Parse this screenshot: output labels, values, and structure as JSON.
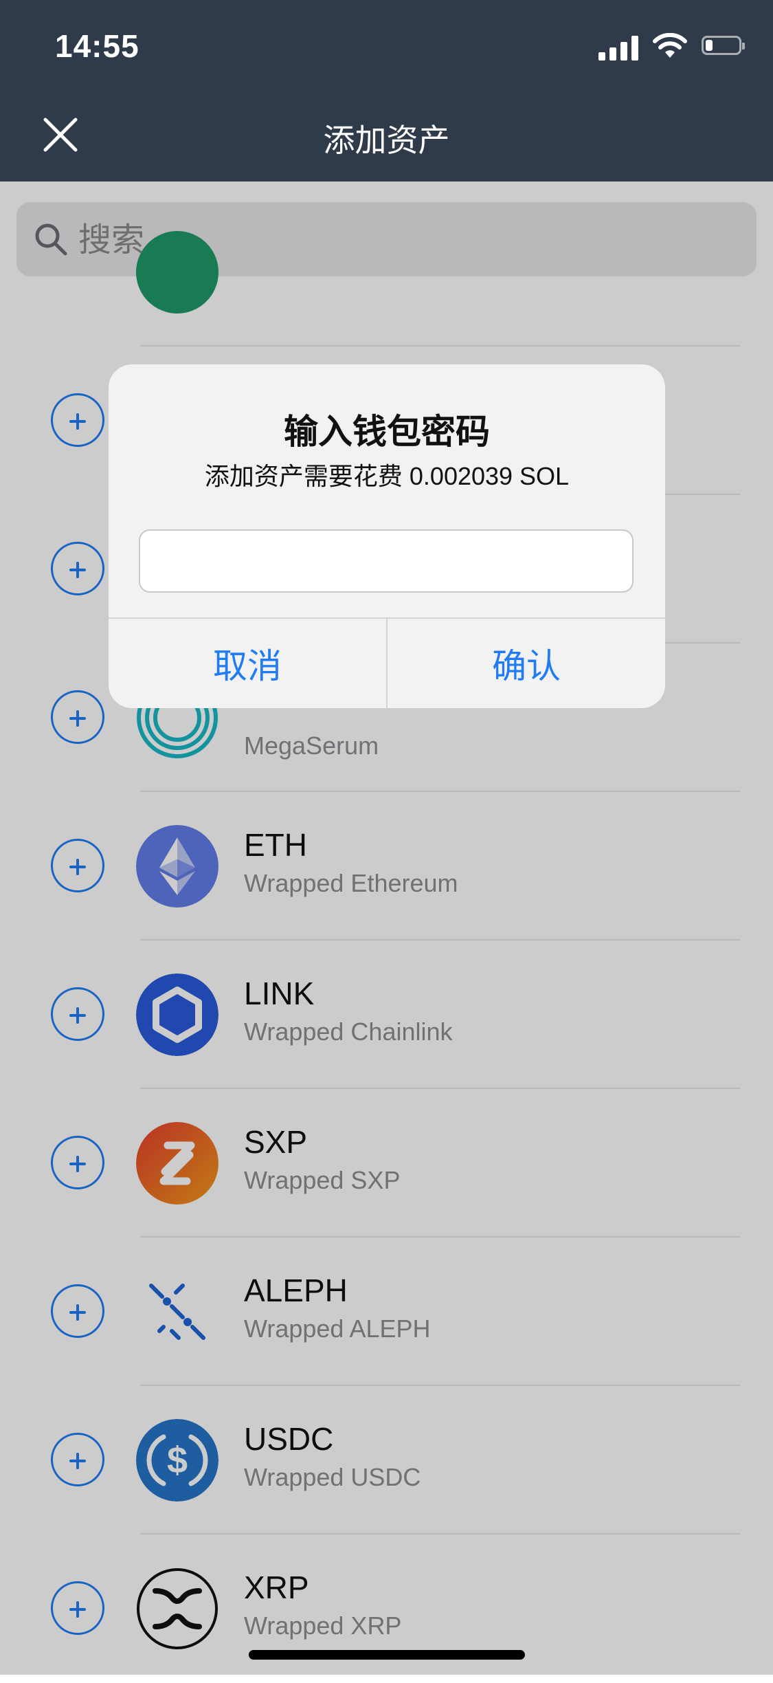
{
  "status_bar": {
    "time": "14:55"
  },
  "header": {
    "title": "添加资产"
  },
  "search": {
    "placeholder": "搜索"
  },
  "tokens": [
    {
      "symbol": "",
      "name": "",
      "logo": "green-token-icon"
    },
    {
      "symbol": "",
      "name": "",
      "logo": "token-icon"
    },
    {
      "symbol": "",
      "name": "",
      "logo": "token-icon"
    },
    {
      "symbol": "",
      "name": "MegaSerum",
      "logo": "megaserum-icon"
    },
    {
      "symbol": "ETH",
      "name": "Wrapped Ethereum",
      "logo": "ethereum-icon"
    },
    {
      "symbol": "LINK",
      "name": "Wrapped Chainlink",
      "logo": "chainlink-icon"
    },
    {
      "symbol": "SXP",
      "name": "Wrapped SXP",
      "logo": "swipe-icon"
    },
    {
      "symbol": "ALEPH",
      "name": "Wrapped ALEPH",
      "logo": "aleph-icon"
    },
    {
      "symbol": "USDC",
      "name": "Wrapped USDC",
      "logo": "usdc-icon"
    },
    {
      "symbol": "XRP",
      "name": "Wrapped XRP",
      "logo": "xrp-icon"
    }
  ],
  "dialog": {
    "title": "输入钱包密码",
    "message": "添加资产需要花费 0.002039 SOL",
    "password_value": "",
    "cancel_label": "取消",
    "confirm_label": "确认"
  },
  "colors": {
    "header_bg": "#2f3a4a",
    "accent": "#1f7cf4",
    "overlay": "rgba(0,0,0,0.2)"
  }
}
